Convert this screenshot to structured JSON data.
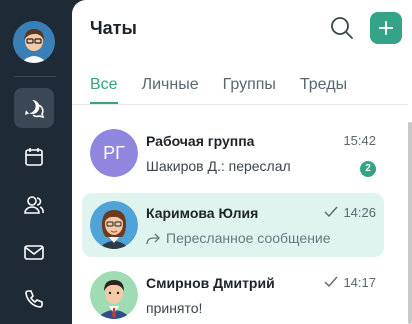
{
  "panel": {
    "title": "Чаты",
    "search_icon": "search-icon",
    "add_icon": "plus-icon"
  },
  "tabs": [
    {
      "label": "Все",
      "active": true
    },
    {
      "label": "Личные",
      "active": false
    },
    {
      "label": "Группы",
      "active": false
    },
    {
      "label": "Треды",
      "active": false
    }
  ],
  "rail": {
    "items": [
      "chats-icon",
      "calendar-icon",
      "contacts-icon",
      "mail-icon",
      "phone-icon"
    ]
  },
  "chats": [
    {
      "initials": "РГ",
      "name": "Рабочая группа",
      "time": "15:42",
      "preview": "Шакиров Д.: переслал",
      "unread": "2"
    },
    {
      "name": "Каримова Юлия",
      "time": "14:26",
      "preview": "Пересланное сообщение",
      "read": true,
      "forwarded": true
    },
    {
      "name": "Смирнов Дмитрий",
      "time": "14:17",
      "preview": "принято!",
      "read": true
    }
  ],
  "colors": {
    "accent": "#35a387",
    "rail": "#1e2a36",
    "selected_row": "#dff4ef",
    "group_avatar": "#8f86e0"
  }
}
